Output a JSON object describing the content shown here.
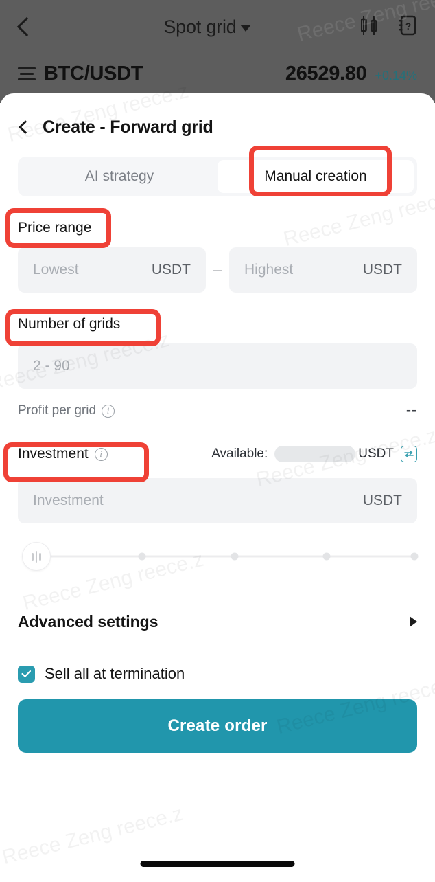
{
  "nav": {
    "back_icon": "chevron-left-icon",
    "title": "Spot grid",
    "caret_icon": "caret-down-icon",
    "chart_icon": "candlestick-chart-icon",
    "help_icon": "help-book-icon"
  },
  "pair": {
    "list_icon": "list-lines-icon",
    "symbol": "BTC/USDT",
    "price": "26529.80",
    "change": "+0.14%",
    "change_color": "#25707a"
  },
  "sheet": {
    "back_icon": "chevron-left-icon",
    "title": "Create - Forward grid"
  },
  "tabs": [
    {
      "label": "AI strategy",
      "active": false
    },
    {
      "label": "Manual creation",
      "active": true
    }
  ],
  "price_range": {
    "label": "Price range",
    "lowest_placeholder": "Lowest",
    "lowest_value": "",
    "lowest_unit": "USDT",
    "separator": "–",
    "highest_placeholder": "Highest",
    "highest_value": "",
    "highest_unit": "USDT"
  },
  "grids": {
    "label": "Number of grids",
    "placeholder": "2 - 90",
    "value": "",
    "profit_label": "Profit per grid",
    "profit_info_icon": "info-icon",
    "profit_value": "--"
  },
  "investment": {
    "label": "Investment",
    "info_icon": "info-icon",
    "available_label": "Available:",
    "available_value": "",
    "available_unit": "USDT",
    "transfer_icon": "transfer-icon",
    "placeholder": "Investment",
    "value": "",
    "unit": "USDT",
    "slider_percent": 0,
    "slider_ticks": [
      25,
      50,
      75,
      100
    ]
  },
  "advanced": {
    "label": "Advanced settings",
    "arrow_icon": "chevron-right-icon"
  },
  "terminate": {
    "label": "Sell all at termination",
    "checked": true,
    "check_icon": "checkmark-icon"
  },
  "cta": {
    "label": "Create order",
    "color": "#2196ac"
  },
  "annotations": [
    {
      "target": "Manual creation"
    },
    {
      "target": "Price range"
    },
    {
      "target": "Number of grids"
    },
    {
      "target": "Investment"
    }
  ],
  "watermarks": [
    "Reece Zeng reece.z",
    "Reece Zeng reece.z",
    "Reece Zeng reece.z",
    "Reece Zeng reece.z",
    "Reece Zeng reece.z",
    "Reece Zeng reece.z",
    "Reece Zeng reece.z"
  ]
}
